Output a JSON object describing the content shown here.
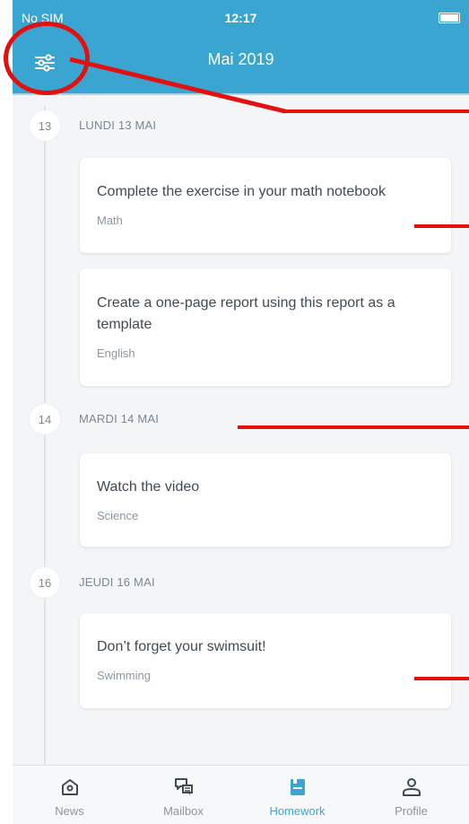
{
  "status_bar": {
    "carrier": "No SIM",
    "time": "12:17"
  },
  "header": {
    "title": "Mai 2019",
    "filter_icon": "sliders-icon",
    "background": "#3aa5d1"
  },
  "days": [
    {
      "number": "13",
      "label": "LUNDI 13 MAI"
    },
    {
      "number": "14",
      "label": "MARDI 14 MAI"
    },
    {
      "number": "16",
      "label": "JEUDI 16 MAI"
    }
  ],
  "homework": [
    {
      "title": "Complete the exercise in your math notebook",
      "subject": "Math"
    },
    {
      "title": "Create a one-page report using this report as a template",
      "subject": "English"
    },
    {
      "title": "Watch the video",
      "subject": "Science"
    },
    {
      "title": "Don’t forget your swimsuit!",
      "subject": "Swimming"
    }
  ],
  "tabs": [
    {
      "label": "News",
      "icon": "home-icon"
    },
    {
      "label": "Mailbox",
      "icon": "chat-icon"
    },
    {
      "label": "Homework",
      "icon": "notebook-icon",
      "active": true
    },
    {
      "label": "Profile",
      "icon": "user-icon"
    }
  ],
  "annotation_color": "#e31010"
}
